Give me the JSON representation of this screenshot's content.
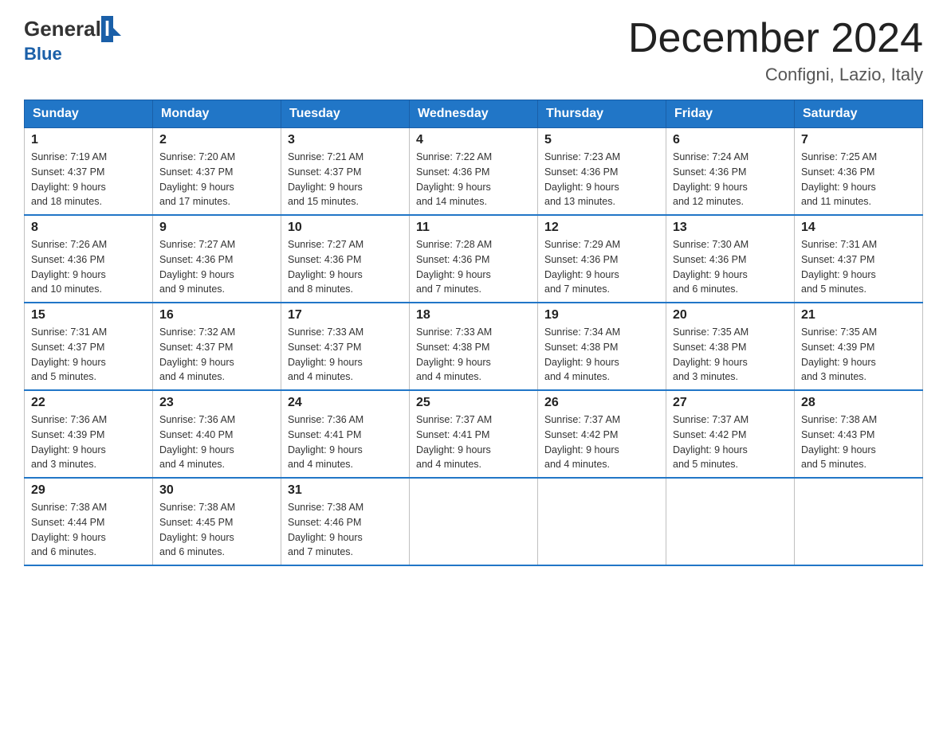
{
  "header": {
    "logo_general": "General",
    "logo_blue": "Blue",
    "title": "December 2024",
    "subtitle": "Configni, Lazio, Italy"
  },
  "weekdays": [
    "Sunday",
    "Monday",
    "Tuesday",
    "Wednesday",
    "Thursday",
    "Friday",
    "Saturday"
  ],
  "weeks": [
    [
      {
        "day": "1",
        "sunrise": "7:19 AM",
        "sunset": "4:37 PM",
        "daylight": "9 hours and 18 minutes."
      },
      {
        "day": "2",
        "sunrise": "7:20 AM",
        "sunset": "4:37 PM",
        "daylight": "9 hours and 17 minutes."
      },
      {
        "day": "3",
        "sunrise": "7:21 AM",
        "sunset": "4:37 PM",
        "daylight": "9 hours and 15 minutes."
      },
      {
        "day": "4",
        "sunrise": "7:22 AM",
        "sunset": "4:36 PM",
        "daylight": "9 hours and 14 minutes."
      },
      {
        "day": "5",
        "sunrise": "7:23 AM",
        "sunset": "4:36 PM",
        "daylight": "9 hours and 13 minutes."
      },
      {
        "day": "6",
        "sunrise": "7:24 AM",
        "sunset": "4:36 PM",
        "daylight": "9 hours and 12 minutes."
      },
      {
        "day": "7",
        "sunrise": "7:25 AM",
        "sunset": "4:36 PM",
        "daylight": "9 hours and 11 minutes."
      }
    ],
    [
      {
        "day": "8",
        "sunrise": "7:26 AM",
        "sunset": "4:36 PM",
        "daylight": "9 hours and 10 minutes."
      },
      {
        "day": "9",
        "sunrise": "7:27 AM",
        "sunset": "4:36 PM",
        "daylight": "9 hours and 9 minutes."
      },
      {
        "day": "10",
        "sunrise": "7:27 AM",
        "sunset": "4:36 PM",
        "daylight": "9 hours and 8 minutes."
      },
      {
        "day": "11",
        "sunrise": "7:28 AM",
        "sunset": "4:36 PM",
        "daylight": "9 hours and 7 minutes."
      },
      {
        "day": "12",
        "sunrise": "7:29 AM",
        "sunset": "4:36 PM",
        "daylight": "9 hours and 7 minutes."
      },
      {
        "day": "13",
        "sunrise": "7:30 AM",
        "sunset": "4:36 PM",
        "daylight": "9 hours and 6 minutes."
      },
      {
        "day": "14",
        "sunrise": "7:31 AM",
        "sunset": "4:37 PM",
        "daylight": "9 hours and 5 minutes."
      }
    ],
    [
      {
        "day": "15",
        "sunrise": "7:31 AM",
        "sunset": "4:37 PM",
        "daylight": "9 hours and 5 minutes."
      },
      {
        "day": "16",
        "sunrise": "7:32 AM",
        "sunset": "4:37 PM",
        "daylight": "9 hours and 4 minutes."
      },
      {
        "day": "17",
        "sunrise": "7:33 AM",
        "sunset": "4:37 PM",
        "daylight": "9 hours and 4 minutes."
      },
      {
        "day": "18",
        "sunrise": "7:33 AM",
        "sunset": "4:38 PM",
        "daylight": "9 hours and 4 minutes."
      },
      {
        "day": "19",
        "sunrise": "7:34 AM",
        "sunset": "4:38 PM",
        "daylight": "9 hours and 4 minutes."
      },
      {
        "day": "20",
        "sunrise": "7:35 AM",
        "sunset": "4:38 PM",
        "daylight": "9 hours and 3 minutes."
      },
      {
        "day": "21",
        "sunrise": "7:35 AM",
        "sunset": "4:39 PM",
        "daylight": "9 hours and 3 minutes."
      }
    ],
    [
      {
        "day": "22",
        "sunrise": "7:36 AM",
        "sunset": "4:39 PM",
        "daylight": "9 hours and 3 minutes."
      },
      {
        "day": "23",
        "sunrise": "7:36 AM",
        "sunset": "4:40 PM",
        "daylight": "9 hours and 4 minutes."
      },
      {
        "day": "24",
        "sunrise": "7:36 AM",
        "sunset": "4:41 PM",
        "daylight": "9 hours and 4 minutes."
      },
      {
        "day": "25",
        "sunrise": "7:37 AM",
        "sunset": "4:41 PM",
        "daylight": "9 hours and 4 minutes."
      },
      {
        "day": "26",
        "sunrise": "7:37 AM",
        "sunset": "4:42 PM",
        "daylight": "9 hours and 4 minutes."
      },
      {
        "day": "27",
        "sunrise": "7:37 AM",
        "sunset": "4:42 PM",
        "daylight": "9 hours and 5 minutes."
      },
      {
        "day": "28",
        "sunrise": "7:38 AM",
        "sunset": "4:43 PM",
        "daylight": "9 hours and 5 minutes."
      }
    ],
    [
      {
        "day": "29",
        "sunrise": "7:38 AM",
        "sunset": "4:44 PM",
        "daylight": "9 hours and 6 minutes."
      },
      {
        "day": "30",
        "sunrise": "7:38 AM",
        "sunset": "4:45 PM",
        "daylight": "9 hours and 6 minutes."
      },
      {
        "day": "31",
        "sunrise": "7:38 AM",
        "sunset": "4:46 PM",
        "daylight": "9 hours and 7 minutes."
      },
      null,
      null,
      null,
      null
    ]
  ],
  "labels": {
    "sunrise": "Sunrise:",
    "sunset": "Sunset:",
    "daylight": "Daylight:"
  }
}
